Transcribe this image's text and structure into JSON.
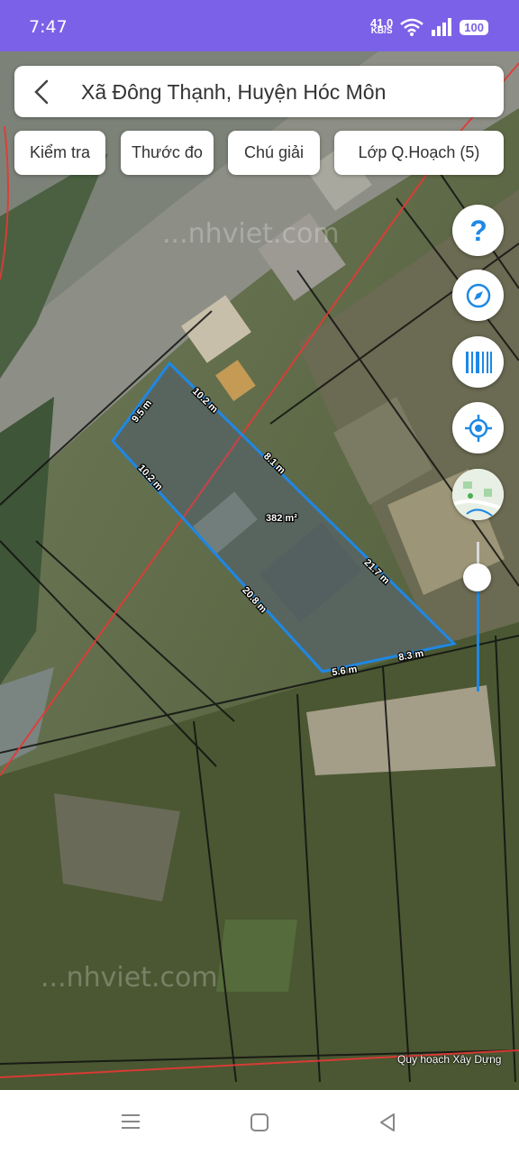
{
  "status_bar": {
    "time": "7:47",
    "net_speed_value": "41.0",
    "net_speed_unit": "KB/S",
    "battery": "100"
  },
  "search_bar": {
    "title": "Xã Đông Thạnh, Huyện Hóc Môn"
  },
  "toolbar": {
    "check_label": "Kiểm tra",
    "measure_label": "Thước đo",
    "legend_label": "Chú giải",
    "planning_layer_label": "Lớp Q.Hoạch (5)"
  },
  "side_controls": [
    "help-icon",
    "compass-icon",
    "barcode-icon",
    "my-location-icon",
    "map-layer-thumbnail"
  ],
  "map": {
    "watermark_top": "...nhviet.com",
    "watermark_bottom": "...nhviet.com",
    "credit": "Quy hoạch Xây Dựng",
    "parcel": {
      "area": "382 m²",
      "edge_labels": [
        "10.2 m",
        "9.5 m",
        "10.2 m",
        "8.1 m",
        "21.7 m",
        "20.8 m",
        "5.6 m",
        "8.3 m"
      ]
    },
    "accent_color": "#1e88e5",
    "boundary_color": "#e53935"
  },
  "nav_bar": [
    "menu-icon",
    "home-icon",
    "back-icon"
  ]
}
